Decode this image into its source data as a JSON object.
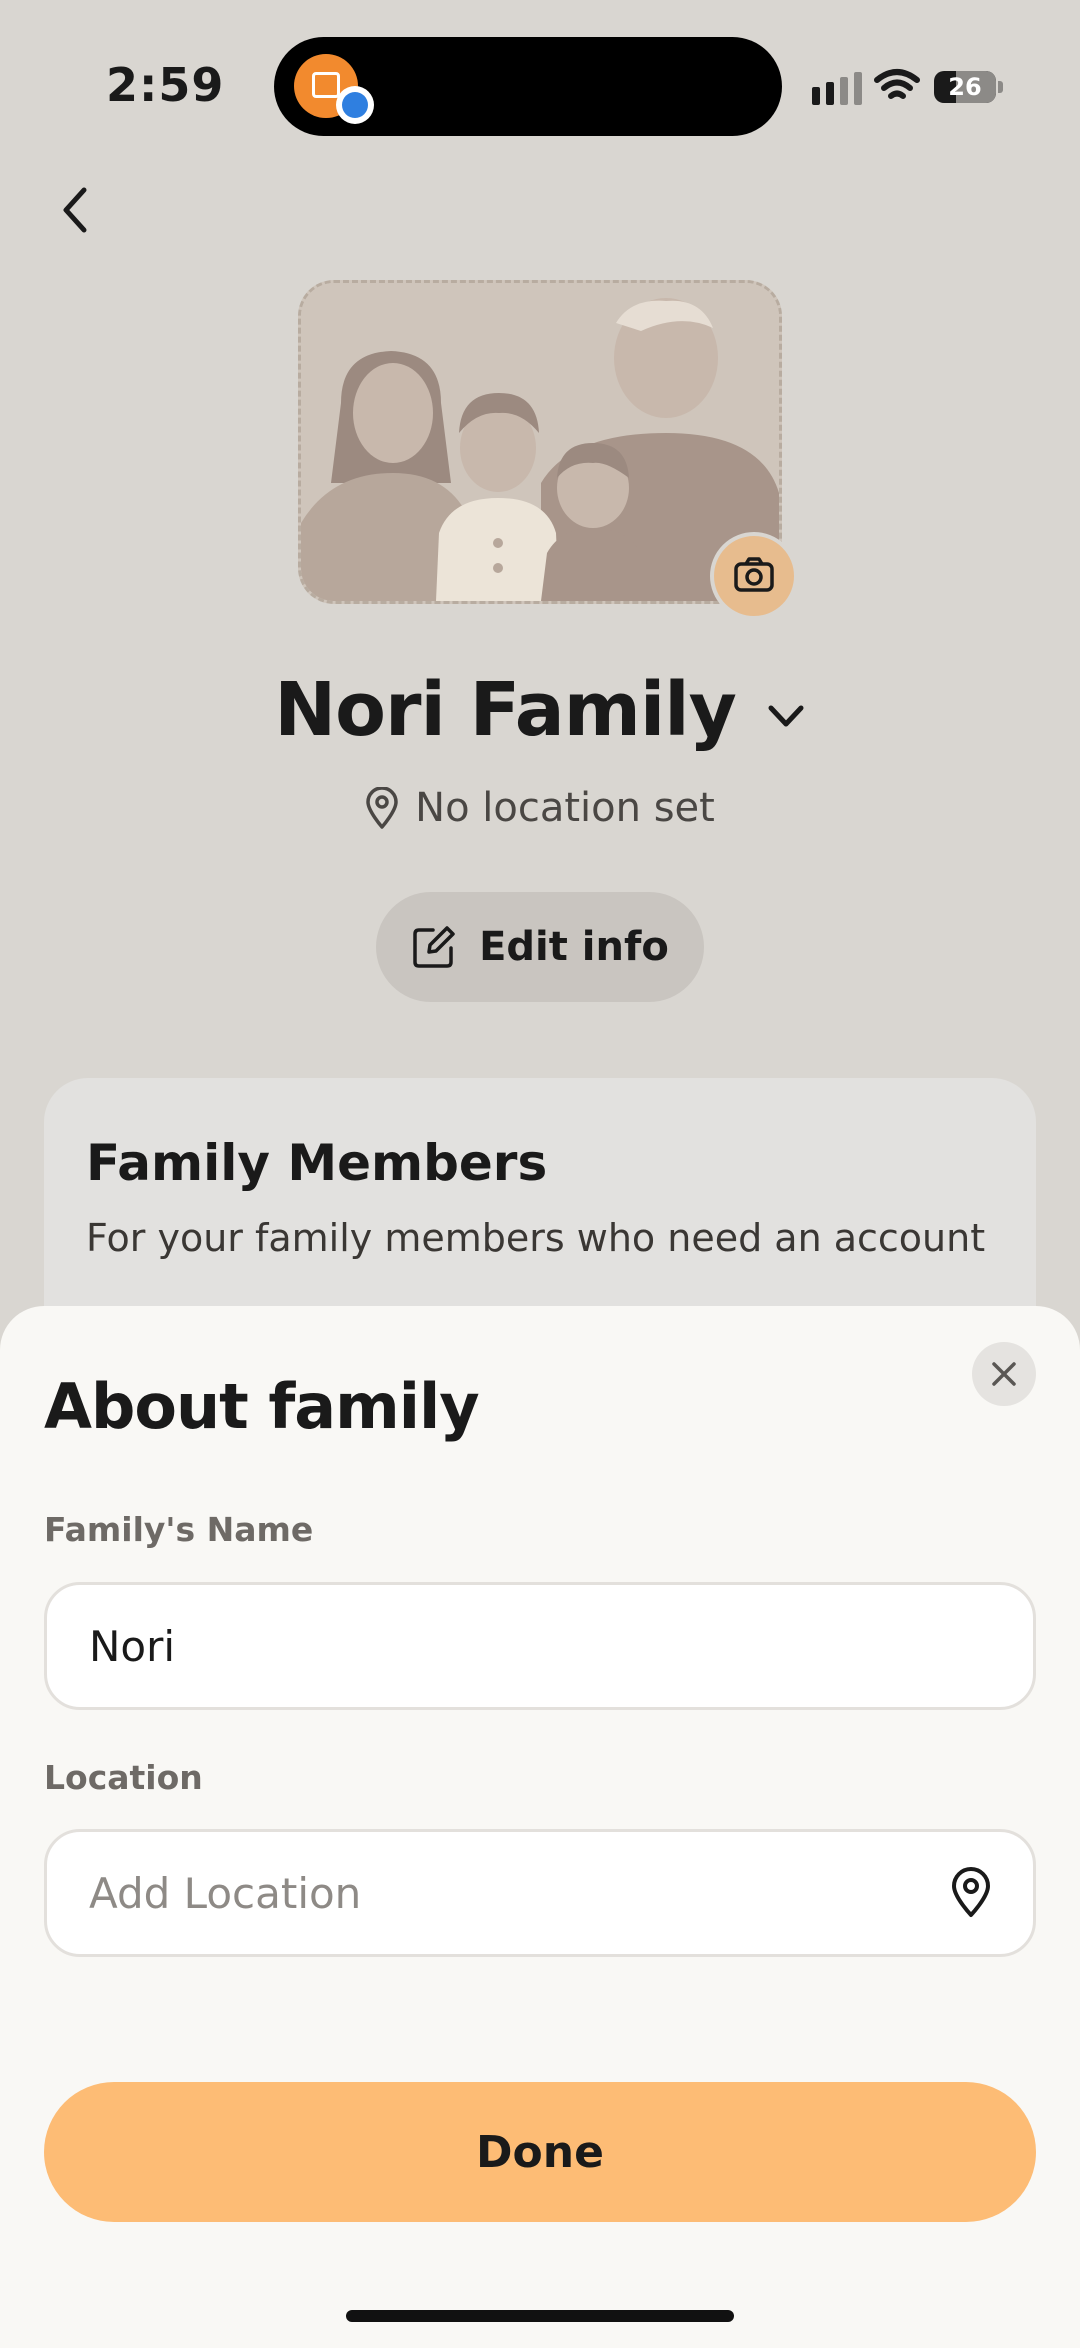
{
  "status_bar": {
    "time": "2:59",
    "battery": "26",
    "island_app_icon": "calendar-icon",
    "island_badge_icon": "blue-badge-icon"
  },
  "nav": {
    "back_icon": "chevron-left-icon"
  },
  "profile": {
    "family_name": "Nori Family",
    "location_text": "No location set",
    "edit_label": "Edit info",
    "photo_icon": "camera-icon"
  },
  "members_card": {
    "title": "Family Members",
    "subtitle": "For your family members who need an account"
  },
  "sheet": {
    "title": "About family",
    "name_label": "Family's Name",
    "name_value": "Nori",
    "location_label": "Location",
    "location_placeholder": "Add Location",
    "done_label": "Done"
  },
  "colors": {
    "background": "#d9d6d1",
    "accent": "#fdbc75",
    "sheet": "#f9f8f5"
  }
}
